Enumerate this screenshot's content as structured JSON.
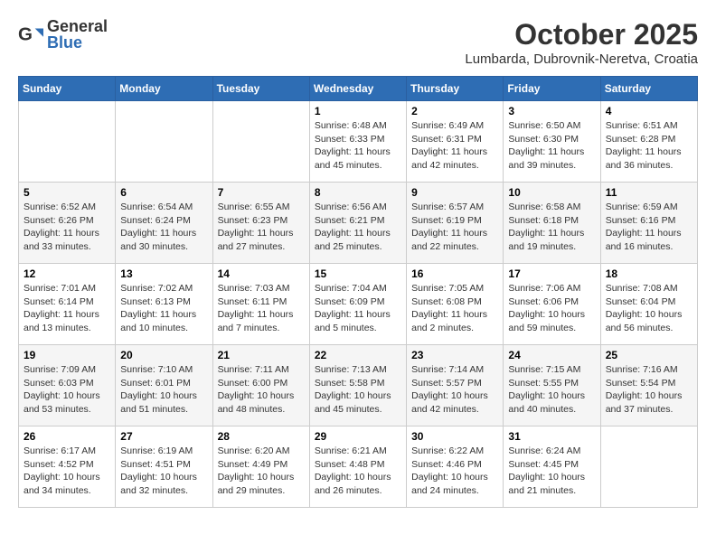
{
  "header": {
    "logo": {
      "general": "General",
      "blue": "Blue"
    },
    "title": "October 2025",
    "subtitle": "Lumbarda, Dubrovnik-Neretva, Croatia"
  },
  "weekdays": [
    "Sunday",
    "Monday",
    "Tuesday",
    "Wednesday",
    "Thursday",
    "Friday",
    "Saturday"
  ],
  "weeks": [
    [
      {
        "day": "",
        "info": ""
      },
      {
        "day": "",
        "info": ""
      },
      {
        "day": "",
        "info": ""
      },
      {
        "day": "1",
        "info": "Sunrise: 6:48 AM\nSunset: 6:33 PM\nDaylight: 11 hours and 45 minutes."
      },
      {
        "day": "2",
        "info": "Sunrise: 6:49 AM\nSunset: 6:31 PM\nDaylight: 11 hours and 42 minutes."
      },
      {
        "day": "3",
        "info": "Sunrise: 6:50 AM\nSunset: 6:30 PM\nDaylight: 11 hours and 39 minutes."
      },
      {
        "day": "4",
        "info": "Sunrise: 6:51 AM\nSunset: 6:28 PM\nDaylight: 11 hours and 36 minutes."
      }
    ],
    [
      {
        "day": "5",
        "info": "Sunrise: 6:52 AM\nSunset: 6:26 PM\nDaylight: 11 hours and 33 minutes."
      },
      {
        "day": "6",
        "info": "Sunrise: 6:54 AM\nSunset: 6:24 PM\nDaylight: 11 hours and 30 minutes."
      },
      {
        "day": "7",
        "info": "Sunrise: 6:55 AM\nSunset: 6:23 PM\nDaylight: 11 hours and 27 minutes."
      },
      {
        "day": "8",
        "info": "Sunrise: 6:56 AM\nSunset: 6:21 PM\nDaylight: 11 hours and 25 minutes."
      },
      {
        "day": "9",
        "info": "Sunrise: 6:57 AM\nSunset: 6:19 PM\nDaylight: 11 hours and 22 minutes."
      },
      {
        "day": "10",
        "info": "Sunrise: 6:58 AM\nSunset: 6:18 PM\nDaylight: 11 hours and 19 minutes."
      },
      {
        "day": "11",
        "info": "Sunrise: 6:59 AM\nSunset: 6:16 PM\nDaylight: 11 hours and 16 minutes."
      }
    ],
    [
      {
        "day": "12",
        "info": "Sunrise: 7:01 AM\nSunset: 6:14 PM\nDaylight: 11 hours and 13 minutes."
      },
      {
        "day": "13",
        "info": "Sunrise: 7:02 AM\nSunset: 6:13 PM\nDaylight: 11 hours and 10 minutes."
      },
      {
        "day": "14",
        "info": "Sunrise: 7:03 AM\nSunset: 6:11 PM\nDaylight: 11 hours and 7 minutes."
      },
      {
        "day": "15",
        "info": "Sunrise: 7:04 AM\nSunset: 6:09 PM\nDaylight: 11 hours and 5 minutes."
      },
      {
        "day": "16",
        "info": "Sunrise: 7:05 AM\nSunset: 6:08 PM\nDaylight: 11 hours and 2 minutes."
      },
      {
        "day": "17",
        "info": "Sunrise: 7:06 AM\nSunset: 6:06 PM\nDaylight: 10 hours and 59 minutes."
      },
      {
        "day": "18",
        "info": "Sunrise: 7:08 AM\nSunset: 6:04 PM\nDaylight: 10 hours and 56 minutes."
      }
    ],
    [
      {
        "day": "19",
        "info": "Sunrise: 7:09 AM\nSunset: 6:03 PM\nDaylight: 10 hours and 53 minutes."
      },
      {
        "day": "20",
        "info": "Sunrise: 7:10 AM\nSunset: 6:01 PM\nDaylight: 10 hours and 51 minutes."
      },
      {
        "day": "21",
        "info": "Sunrise: 7:11 AM\nSunset: 6:00 PM\nDaylight: 10 hours and 48 minutes."
      },
      {
        "day": "22",
        "info": "Sunrise: 7:13 AM\nSunset: 5:58 PM\nDaylight: 10 hours and 45 minutes."
      },
      {
        "day": "23",
        "info": "Sunrise: 7:14 AM\nSunset: 5:57 PM\nDaylight: 10 hours and 42 minutes."
      },
      {
        "day": "24",
        "info": "Sunrise: 7:15 AM\nSunset: 5:55 PM\nDaylight: 10 hours and 40 minutes."
      },
      {
        "day": "25",
        "info": "Sunrise: 7:16 AM\nSunset: 5:54 PM\nDaylight: 10 hours and 37 minutes."
      }
    ],
    [
      {
        "day": "26",
        "info": "Sunrise: 6:17 AM\nSunset: 4:52 PM\nDaylight: 10 hours and 34 minutes."
      },
      {
        "day": "27",
        "info": "Sunrise: 6:19 AM\nSunset: 4:51 PM\nDaylight: 10 hours and 32 minutes."
      },
      {
        "day": "28",
        "info": "Sunrise: 6:20 AM\nSunset: 4:49 PM\nDaylight: 10 hours and 29 minutes."
      },
      {
        "day": "29",
        "info": "Sunrise: 6:21 AM\nSunset: 4:48 PM\nDaylight: 10 hours and 26 minutes."
      },
      {
        "day": "30",
        "info": "Sunrise: 6:22 AM\nSunset: 4:46 PM\nDaylight: 10 hours and 24 minutes."
      },
      {
        "day": "31",
        "info": "Sunrise: 6:24 AM\nSunset: 4:45 PM\nDaylight: 10 hours and 21 minutes."
      },
      {
        "day": "",
        "info": ""
      }
    ]
  ]
}
